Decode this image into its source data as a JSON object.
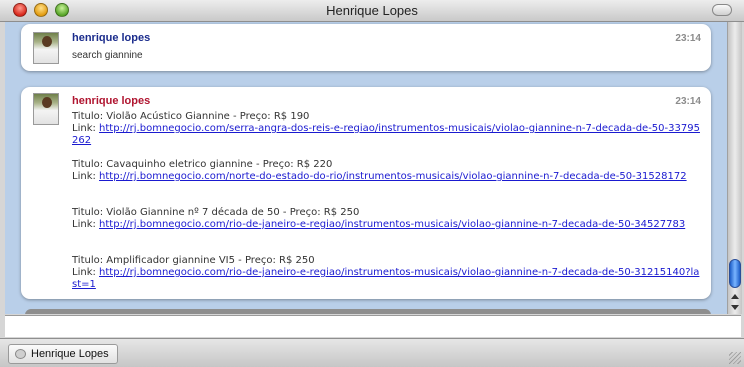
{
  "window": {
    "title": "Henrique Lopes"
  },
  "messages": [
    {
      "sender": "henrique lopes",
      "time": "23:14",
      "text": "search giannine"
    },
    {
      "sender": "henrique lopes",
      "time": "23:14",
      "listings": [
        {
          "title": "Titulo: Violão Acústico Giannine - Preço: R$ 190",
          "link_prefix": "Link: ",
          "link": "http://rj.bomnegocio.com/serra-angra-dos-reis-e-regiao/instrumentos-musicais/violao-giannine-n-7-decada-de-50-33795262"
        },
        {
          "title": "Titulo: Cavaquinho eletrico giannine - Preço: R$ 220",
          "link_prefix": "Link: ",
          "link": "http://rj.bomnegocio.com/norte-do-estado-do-rio/instrumentos-musicais/violao-giannine-n-7-decada-de-50-31528172"
        },
        {
          "title": "Titulo: Violão Giannine nº 7 década de 50 - Preço: R$ 250",
          "link_prefix": "Link: ",
          "link": "http://rj.bomnegocio.com/rio-de-janeiro-e-regiao/instrumentos-musicais/violao-giannine-n-7-decada-de-50-34527783"
        },
        {
          "title": "Titulo: Amplificador giannine VI5 - Preço: R$ 250",
          "link_prefix": "Link: ",
          "link": "http://rj.bomnegocio.com/rio-de-janeiro-e-regiao/instrumentos-musicais/violao-giannine-n-7-decada-de-50-31215140?last=1"
        }
      ]
    }
  ],
  "tabs": [
    {
      "label": "Henrique Lopes"
    }
  ],
  "colors": {
    "incoming_sender": "#1b2c8c",
    "outgoing_sender": "#b01530",
    "link": "#1a1ad0",
    "chat_background": "#b9cfe9"
  },
  "icons": {
    "close": "close-icon",
    "minimize": "minimize-icon",
    "zoom": "zoom-icon",
    "toolbar_toggle": "toolbar-toggle-icon",
    "avatar": "avatar",
    "tab": "chat-bubble-icon"
  }
}
